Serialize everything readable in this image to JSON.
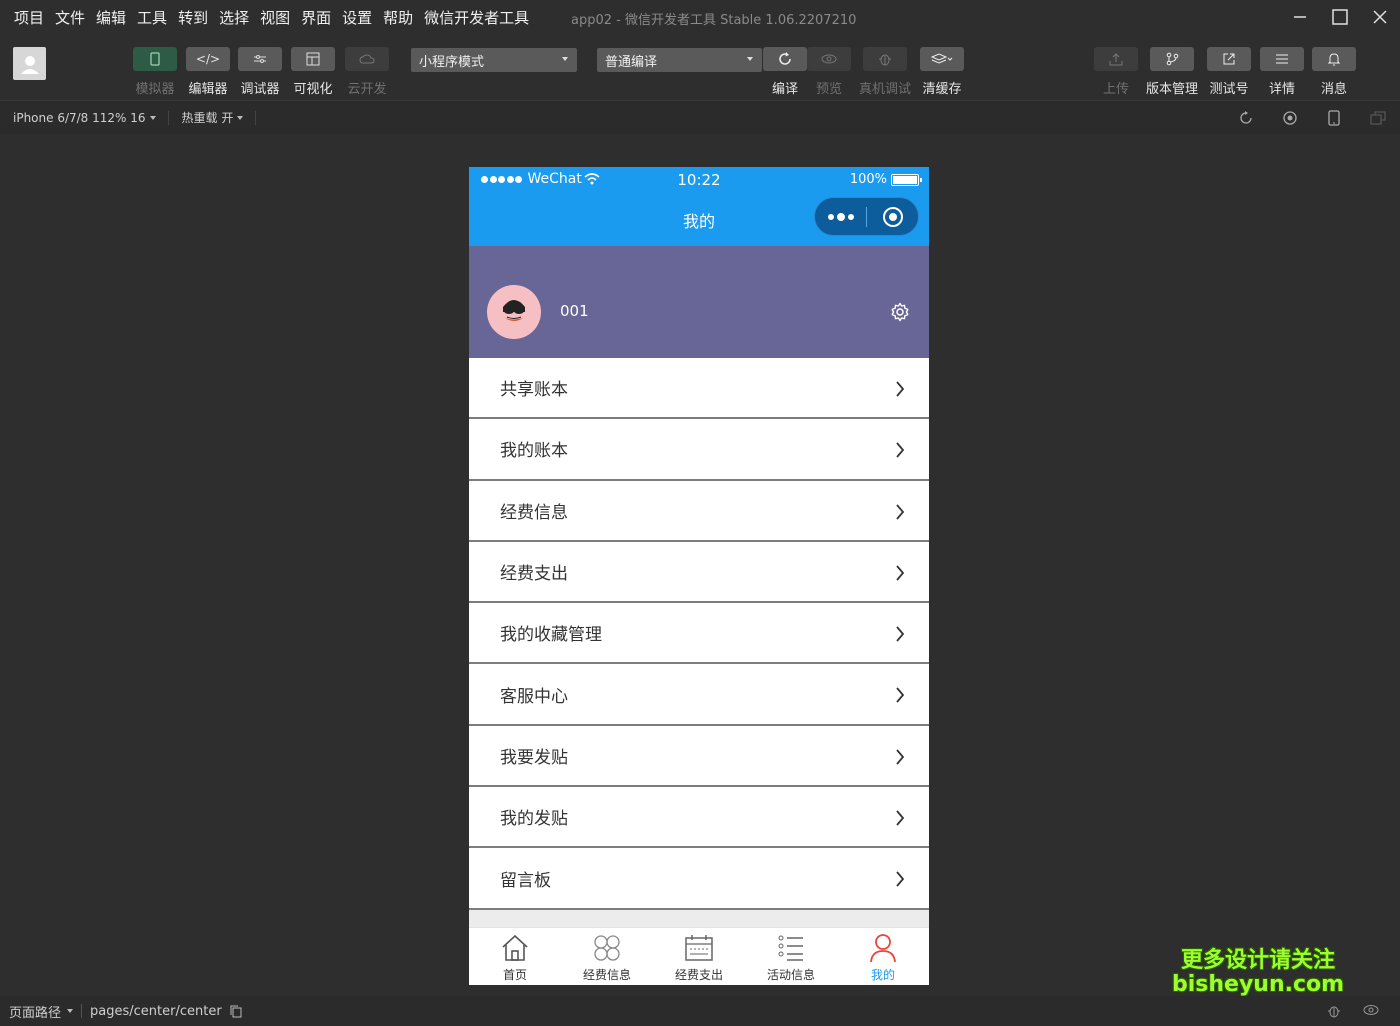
{
  "menubar": {
    "items": [
      "项目",
      "文件",
      "编辑",
      "工具",
      "转到",
      "选择",
      "视图",
      "界面",
      "设置",
      "帮助",
      "微信开发者工具"
    ],
    "window_title": "app02 - 微信开发者工具 Stable 1.06.2207210"
  },
  "toolbar": {
    "simulator": "模拟器",
    "editor": "编辑器",
    "debugger": "调试器",
    "visual": "可视化",
    "cloud": "云开发",
    "mode_select": "小程序模式",
    "compile_select": "普通编译",
    "compile": "编译",
    "preview": "预览",
    "remote_debug": "真机调试",
    "clear_cache": "清缓存",
    "upload": "上传",
    "version": "版本管理",
    "test_account": "测试号",
    "details": "详情",
    "messages": "消息"
  },
  "subbar": {
    "device": "iPhone 6/7/8 112% 16",
    "hot_reload": "热重载 开"
  },
  "phone": {
    "status": {
      "carrier": "WeChat",
      "time": "10:22",
      "battery": "100%"
    },
    "nav_title": "我的",
    "profile_name": "001",
    "menu": [
      "共享账本",
      "我的账本",
      "经费信息",
      "经费支出",
      "我的收藏管理",
      "客服中心",
      "我要发贴",
      "我的发贴",
      "留言板"
    ],
    "tabs": [
      "首页",
      "经费信息",
      "经费支出",
      "活动信息",
      "我的"
    ],
    "accent": "#1a9bf0",
    "profile_bg": "#676697"
  },
  "bottombar": {
    "path_label": "页面路径",
    "path": "pages/center/center"
  },
  "watermark": {
    "line1": "更多设计请关注",
    "line2": "bisheyun.com"
  }
}
